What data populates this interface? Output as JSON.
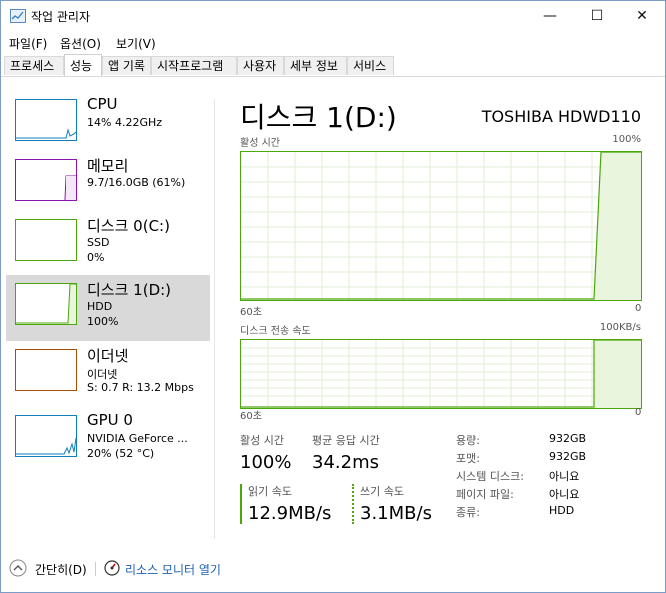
{
  "window": {
    "title": "작업 관리자"
  },
  "controls": {
    "minimize": "—",
    "maximize": "☐",
    "close": "✕"
  },
  "menu": [
    "파일(F)",
    "옵션(O)",
    "보기(V)"
  ],
  "tabs": [
    "프로세스",
    "성능",
    "앱 기록",
    "시작프로그램",
    "사용자",
    "세부 정보",
    "서비스"
  ],
  "active_tab": "성능",
  "sidebar": {
    "items": [
      {
        "title": "CPU",
        "line1": "14%  4.22GHz",
        "line2": "",
        "color": "#117dbb"
      },
      {
        "title": "메모리",
        "line1": "9.7/16.0GB (61%)",
        "line2": "",
        "color": "#8b12ae"
      },
      {
        "title": "디스크 0(C:)",
        "line1": "SSD",
        "line2": "0%",
        "color": "#4da60c"
      },
      {
        "title": "디스크 1(D:)",
        "line1": "HDD",
        "line2": "100%",
        "color": "#4da60c"
      },
      {
        "title": "이더넷",
        "line1": "이더넷",
        "line2": "S: 0.7  R: 13.2 Mbps",
        "color": "#a74f01"
      },
      {
        "title": "GPU 0",
        "line1": "NVIDIA GeForce ...",
        "line2": "20% (52 °C)",
        "color": "#117dbb"
      }
    ],
    "selected_index": 3
  },
  "main": {
    "title": "디스크 1(D:)",
    "model": "TOSHIBA HDWD110",
    "graph1": {
      "label": "활성 시간",
      "max": "100%",
      "x_left": "60초",
      "x_right": "0"
    },
    "graph2": {
      "label": "디스크 전송 속도",
      "max": "100KB/s",
      "x_left": "60초",
      "x_right": "0"
    }
  },
  "stats": {
    "active_time_label": "활성 시간",
    "active_time": "100%",
    "avg_response_label": "평균 응답 시간",
    "avg_response": "34.2ms",
    "read_label": "읽기 속도",
    "read": "12.9MB/s",
    "write_label": "쓰기 속도",
    "write": "3.1MB/s"
  },
  "details": [
    {
      "key": "용량:",
      "value": "932GB"
    },
    {
      "key": "포맷:",
      "value": "932GB"
    },
    {
      "key": "시스템 디스크:",
      "value": "아니요"
    },
    {
      "key": "페이지 파일:",
      "value": "아니요"
    },
    {
      "key": "종류:",
      "value": "HDD"
    }
  ],
  "footer": {
    "collapse": "간단히(D)",
    "resource_monitor": "리소스 모니터 열기"
  },
  "colors": {
    "disk_green": "#4da60c",
    "disk_fill": "#e9f5dd",
    "link": "#1e5fb4"
  }
}
